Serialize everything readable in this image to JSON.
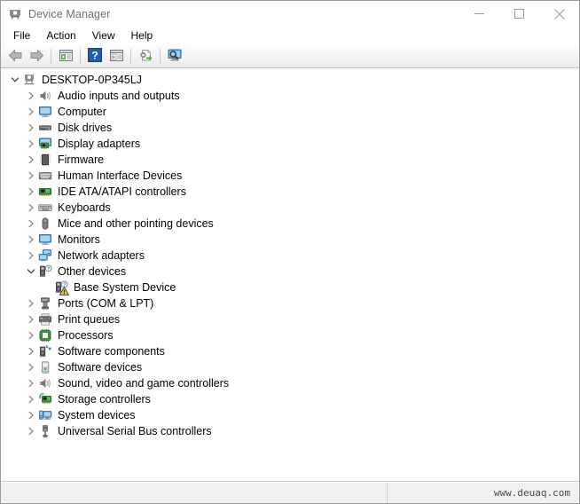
{
  "window": {
    "title": "Device Manager",
    "title_icon": "device-manager-icon"
  },
  "caption": {
    "minimize": "minimize-icon",
    "maximize": "maximize-icon",
    "close": "close-icon"
  },
  "menubar": {
    "items": [
      {
        "label": "File"
      },
      {
        "label": "Action"
      },
      {
        "label": "View"
      },
      {
        "label": "Help"
      }
    ]
  },
  "toolbar": {
    "buttons": [
      {
        "name": "back-button",
        "icon": "back-arrow-icon"
      },
      {
        "name": "forward-button",
        "icon": "forward-arrow-icon"
      },
      {
        "name": "separator-1",
        "icon": "separator"
      },
      {
        "name": "properties-button",
        "icon": "properties-window-icon"
      },
      {
        "name": "separator-2",
        "icon": "separator"
      },
      {
        "name": "help-button",
        "icon": "question-mark-icon"
      },
      {
        "name": "show-hidden-button",
        "icon": "window-play-icon"
      },
      {
        "name": "separator-3",
        "icon": "separator"
      },
      {
        "name": "update-driver-button",
        "icon": "gear-page-icon"
      },
      {
        "name": "separator-4",
        "icon": "separator"
      },
      {
        "name": "scan-hardware-button",
        "icon": "monitor-magnifier-icon"
      }
    ]
  },
  "tree": {
    "nodes": [
      {
        "label": "DESKTOP-0P345LJ",
        "level": 0,
        "state": "expanded",
        "icon": "computer-node-icon",
        "warning": false
      },
      {
        "label": "Audio inputs and outputs",
        "level": 1,
        "state": "collapsed",
        "icon": "speaker-icon",
        "warning": false
      },
      {
        "label": "Computer",
        "level": 1,
        "state": "collapsed",
        "icon": "monitor-icon",
        "warning": false
      },
      {
        "label": "Disk drives",
        "level": 1,
        "state": "collapsed",
        "icon": "disk-drive-icon",
        "warning": false
      },
      {
        "label": "Display adapters",
        "level": 1,
        "state": "collapsed",
        "icon": "display-adapter-icon",
        "warning": false
      },
      {
        "label": "Firmware",
        "level": 1,
        "state": "collapsed",
        "icon": "firmware-chip-icon",
        "warning": false
      },
      {
        "label": "Human Interface Devices",
        "level": 1,
        "state": "collapsed",
        "icon": "hid-icon",
        "warning": false
      },
      {
        "label": "IDE ATA/ATAPI controllers",
        "level": 1,
        "state": "collapsed",
        "icon": "ide-controller-icon",
        "warning": false
      },
      {
        "label": "Keyboards",
        "level": 1,
        "state": "collapsed",
        "icon": "keyboard-icon",
        "warning": false
      },
      {
        "label": "Mice and other pointing devices",
        "level": 1,
        "state": "collapsed",
        "icon": "mouse-icon",
        "warning": false
      },
      {
        "label": "Monitors",
        "level": 1,
        "state": "collapsed",
        "icon": "monitor-icon",
        "warning": false
      },
      {
        "label": "Network adapters",
        "level": 1,
        "state": "collapsed",
        "icon": "network-adapter-icon",
        "warning": false
      },
      {
        "label": "Other devices",
        "level": 1,
        "state": "expanded",
        "icon": "other-device-icon",
        "warning": false
      },
      {
        "label": "Base System Device",
        "level": 2,
        "state": "leaf",
        "icon": "other-device-icon",
        "warning": true
      },
      {
        "label": "Ports (COM & LPT)",
        "level": 1,
        "state": "collapsed",
        "icon": "port-icon",
        "warning": false
      },
      {
        "label": "Print queues",
        "level": 1,
        "state": "collapsed",
        "icon": "printer-icon",
        "warning": false
      },
      {
        "label": "Processors",
        "level": 1,
        "state": "collapsed",
        "icon": "processor-icon",
        "warning": false
      },
      {
        "label": "Software components",
        "level": 1,
        "state": "collapsed",
        "icon": "software-component-icon",
        "warning": false
      },
      {
        "label": "Software devices",
        "level": 1,
        "state": "collapsed",
        "icon": "software-device-icon",
        "warning": false
      },
      {
        "label": "Sound, video and game controllers",
        "level": 1,
        "state": "collapsed",
        "icon": "speaker-icon",
        "warning": false
      },
      {
        "label": "Storage controllers",
        "level": 1,
        "state": "collapsed",
        "icon": "storage-controller-icon",
        "warning": false
      },
      {
        "label": "System devices",
        "level": 1,
        "state": "collapsed",
        "icon": "system-device-icon",
        "warning": false
      },
      {
        "label": "Universal Serial Bus controllers",
        "level": 1,
        "state": "collapsed",
        "icon": "usb-icon",
        "warning": false
      }
    ]
  },
  "statusbar": {
    "left_text": "",
    "watermark": "www.deuaq.com"
  },
  "colors": {
    "accent_blue": "#3a76b8",
    "warning_yellow": "#f5c518",
    "chrome_gray": "#f0f0f0",
    "border_gray": "#9a9a9a"
  }
}
